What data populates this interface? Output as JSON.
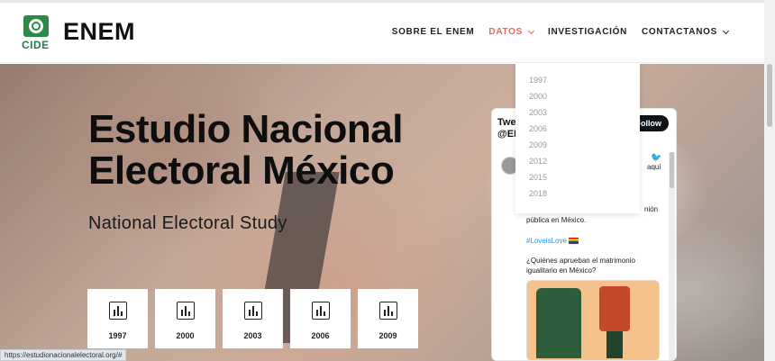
{
  "header": {
    "logo_text": "CIDE",
    "brand": "ENEM",
    "nav": [
      {
        "label": "SOBRE EL ENEM",
        "active": false,
        "has_caret": false
      },
      {
        "label": "DATOS",
        "active": true,
        "has_caret": true
      },
      {
        "label": "INVESTIGACIÓN",
        "active": false,
        "has_caret": false
      },
      {
        "label": "CONTACTANOS",
        "active": false,
        "has_caret": true
      }
    ],
    "accent_color": "#e5675a",
    "logo_color": "#2c8a49"
  },
  "hero": {
    "title": "Estudio Nacional Electoral México",
    "subtitle": "National Electoral Study",
    "cards": [
      {
        "year": "1997",
        "icon": "bar-chart-icon"
      },
      {
        "year": "2000",
        "icon": "bar-chart-icon"
      },
      {
        "year": "2003",
        "icon": "bar-chart-icon"
      },
      {
        "year": "2006",
        "icon": "bar-chart-icon"
      },
      {
        "year": "2009",
        "icon": "bar-chart-icon"
      }
    ]
  },
  "datos_menu": {
    "options": [
      "1997",
      "2000",
      "2003",
      "2006",
      "2009",
      "2012",
      "2015",
      "2018"
    ]
  },
  "twitter": {
    "heading": "Twe\n@EN",
    "follow_label": "Follow",
    "fragment_right_1": "aquí",
    "fragment_right_2": "nión",
    "lines": [
      "pública en México.",
      "#LoveisLove",
      "¿Quiénes aprueban el matrimonio igualitario en México?"
    ]
  },
  "status_bar": {
    "url": "https://estudionacionalelectoral.org/#"
  }
}
